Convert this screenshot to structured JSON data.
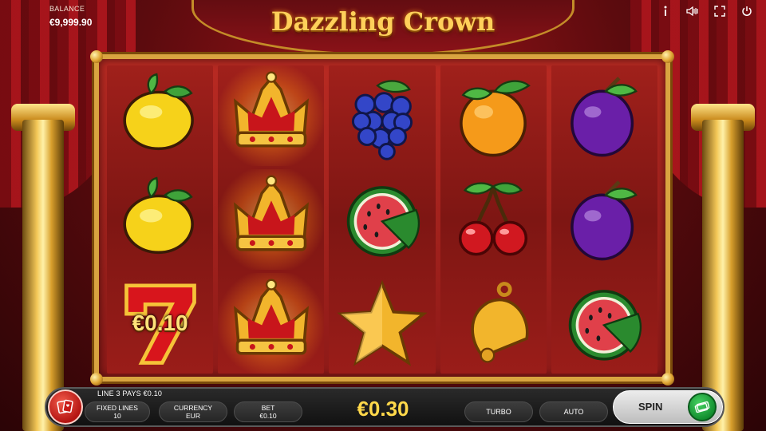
{
  "header": {
    "balance_label": "BALANCE",
    "balance_value": "€9,999.90",
    "logo_text": "Dazzling Crown",
    "icons": [
      "info-icon",
      "sound-icon",
      "fullscreen-icon",
      "power-icon"
    ]
  },
  "reels": [
    [
      "lemon",
      "lemon",
      "seven"
    ],
    [
      "crown",
      "crown",
      "crown"
    ],
    [
      "grapes",
      "watermelon",
      "star"
    ],
    [
      "orange",
      "cherries",
      "bell"
    ],
    [
      "plum",
      "plum",
      "watermelon"
    ]
  ],
  "winning_symbols": "crown",
  "seven_label": "€0.10",
  "bottom": {
    "win_line_text": "LINE 3 PAYS €0.10",
    "fixed_lines_label": "FIXED LINES",
    "fixed_lines_value": "10",
    "currency_label": "CURRENCY",
    "currency_value": "EUR",
    "bet_label": "BET",
    "bet_value": "€0.10",
    "total_bet": "€0.30",
    "turbo_label": "TURBO",
    "auto_label": "AUTO",
    "spin_label": "SPIN"
  },
  "colors": {
    "accent_gold": "#ffd84a",
    "frame_gold": "#d9a440",
    "spin_green": "#1fae44"
  }
}
